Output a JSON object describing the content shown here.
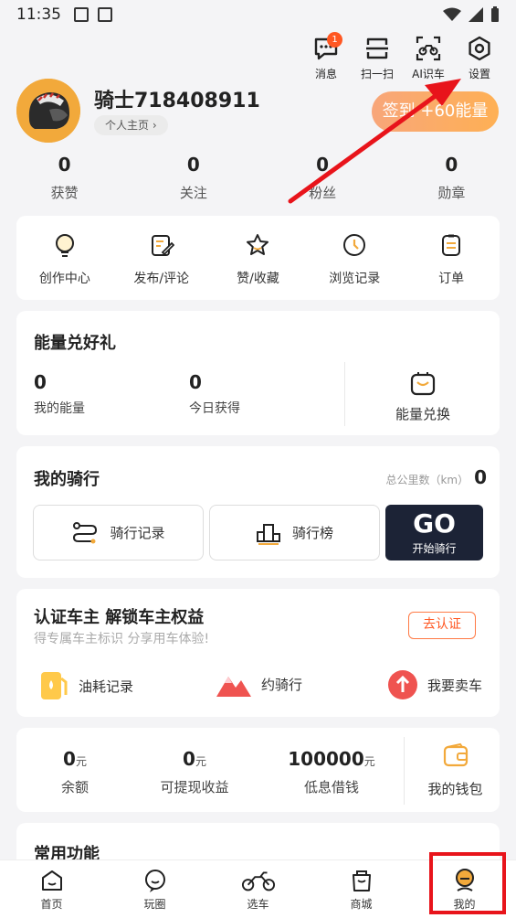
{
  "status": {
    "time": "11:35"
  },
  "top_actions": [
    {
      "label": "消息",
      "icon": "message-icon",
      "badge": "1"
    },
    {
      "label": "扫一扫",
      "icon": "scan-icon"
    },
    {
      "label": "AI识车",
      "icon": "motorcycle-scan-icon"
    },
    {
      "label": "设置",
      "icon": "gear-icon"
    }
  ],
  "profile": {
    "username": "骑士718408911",
    "home_label": "个人主页",
    "checkin_label": "签到 +60能量"
  },
  "stats": [
    {
      "value": "0",
      "label": "获赞"
    },
    {
      "value": "0",
      "label": "关注"
    },
    {
      "value": "0",
      "label": "粉丝"
    },
    {
      "value": "0",
      "label": "勋章"
    }
  ],
  "quick": [
    {
      "label": "创作中心",
      "icon": "bulb-icon"
    },
    {
      "label": "发布/评论",
      "icon": "edit-icon"
    },
    {
      "label": "赞/收藏",
      "icon": "star-icon"
    },
    {
      "label": "浏览记录",
      "icon": "clock-icon"
    },
    {
      "label": "订单",
      "icon": "order-icon"
    }
  ],
  "energy": {
    "title": "能量兑好礼",
    "my_value": "0",
    "my_label": "我的能量",
    "today_value": "0",
    "today_label": "今日获得",
    "exchange_label": "能量兑换"
  },
  "riding": {
    "title": "我的骑行",
    "km_label": "总公里数（km）",
    "km_value": "0",
    "records_label": "骑行记录",
    "rank_label": "骑行榜",
    "go_label": "GO",
    "go_sub": "开始骑行"
  },
  "owner": {
    "title": "认证车主 解锁车主权益",
    "subtitle": "得专属车主标识 分享用车体验!",
    "verify_label": "去认证",
    "perks": [
      "油耗记录",
      "约骑行",
      "我要卖车"
    ]
  },
  "wallet": {
    "balance_value": "0",
    "balance_unit": "元",
    "balance_label": "余额",
    "withdraw_value": "0",
    "withdraw_unit": "元",
    "withdraw_label": "可提现收益",
    "loan_value": "100000",
    "loan_unit": "元",
    "loan_label": "低息借钱",
    "wallet_label": "我的钱包"
  },
  "common": {
    "title": "常用功能"
  },
  "nav": [
    {
      "label": "首页"
    },
    {
      "label": "玩圈"
    },
    {
      "label": "选车"
    },
    {
      "label": "商城"
    },
    {
      "label": "我的"
    }
  ],
  "colors": {
    "accent": "#ff5722",
    "highlight": "#e8141b",
    "checkin": "#ffab47",
    "go": "#1c2336"
  }
}
